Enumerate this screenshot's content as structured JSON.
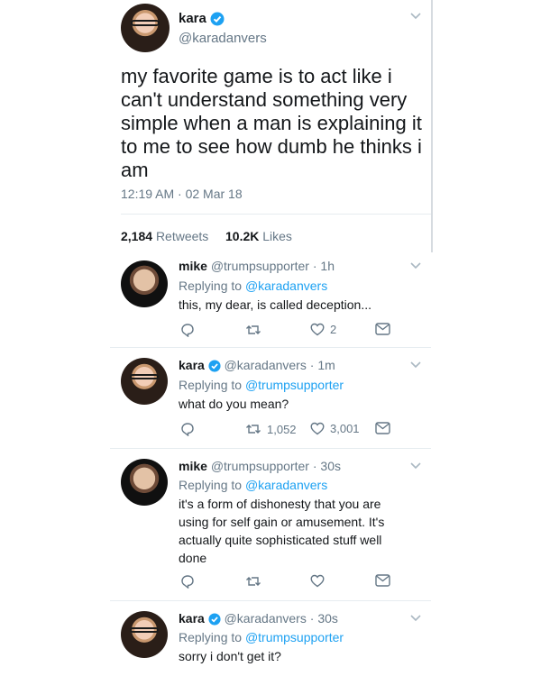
{
  "main": {
    "user": {
      "name": "kara",
      "handle": "@karadanvers"
    },
    "text": [
      "my favorite game is to act like i",
      "can't understand something very",
      "simple when a man is explaining it",
      "to me to see how dumb he thinks i",
      "am"
    ],
    "timestamp": "12:19 AM · 02 Mar 18",
    "retweets": {
      "count": "2,184",
      "label": "Retweets"
    },
    "likes": {
      "count": "10.2K",
      "label": "Likes"
    }
  },
  "replies": [
    {
      "name": "mike",
      "handle": "@trumpsupporter",
      "time": "1h",
      "replying_label": "Replying to",
      "replying_to": "@karadanvers",
      "lines": [
        "this, my dear, is called deception..."
      ],
      "retweets": "",
      "likes": "2"
    },
    {
      "name": "kara",
      "handle": "@karadanvers",
      "time": "1m",
      "replying_label": "Replying to",
      "replying_to": "@trumpsupporter",
      "lines": [
        "what do you mean?"
      ],
      "retweets": "1,052",
      "likes": "3,001"
    },
    {
      "name": "mike",
      "handle": "@trumpsupporter",
      "time": "30s",
      "replying_label": "Replying to",
      "replying_to": "@karadanvers",
      "lines": [
        "it's a form of dishonesty that you are",
        "using for self gain or amusement. It's",
        "actually quite sophisticated stuff well",
        "done"
      ],
      "retweets": "",
      "likes": ""
    },
    {
      "name": "kara",
      "handle": "@karadanvers",
      "time": "30s",
      "replying_label": "Replying to",
      "replying_to": "@trumpsupporter",
      "lines": [
        "sorry i don't get it?"
      ],
      "retweets": "",
      "likes": ""
    }
  ],
  "colors": {
    "accent": "#1da1f2",
    "muted": "#657786",
    "text": "#14171a",
    "divider": "#e6ecf0"
  }
}
